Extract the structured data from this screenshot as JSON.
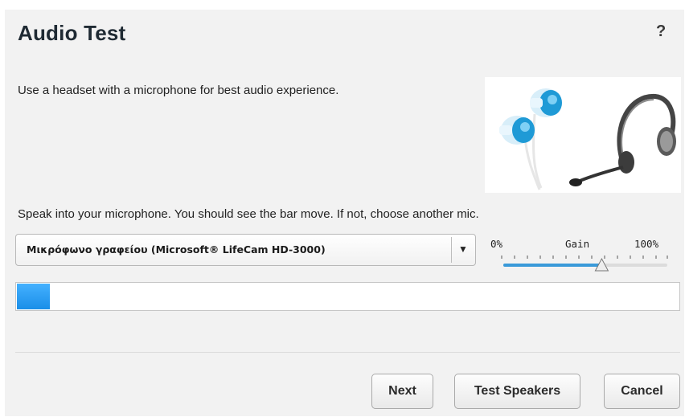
{
  "dialog": {
    "title": "Audio Test",
    "help_label": "?",
    "intro_text": "Use a headset with a microphone for best audio experience.",
    "speak_text": "Speak into your microphone. You should see the bar move. If not, choose another mic."
  },
  "microphone": {
    "selected": "Μικρόφωνο γραφείου (Microsoft® LifeCam HD-3000)",
    "dropdown_icon": "triangle-down-icon"
  },
  "gain": {
    "min_label": "0%",
    "label": "Gain",
    "max_label": "100%",
    "level": 0.6,
    "fill_color": "#3a9ad9"
  },
  "level_meter": {
    "level": 0.05,
    "fill_color": "#2a9df4"
  },
  "buttons": {
    "next": "Next",
    "test_speakers": "Test Speakers",
    "cancel": "Cancel"
  },
  "illustration": {
    "earbuds_color": "#1f9ad6",
    "headset_color": "#555555"
  }
}
